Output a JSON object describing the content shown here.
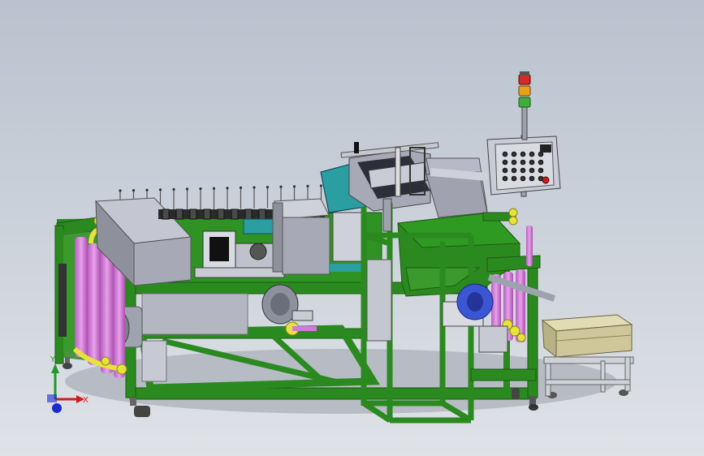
{
  "colors": {
    "background_top": "#b9c2ce",
    "background_bottom": "#dfe2e7",
    "frame_green": "#2b8a1f",
    "frame_green_dark": "#1a5a12",
    "panel_grey": "#a7a9b7",
    "panel_grey_dark": "#7d7f8c",
    "spool_magenta": "#d27ad6",
    "fitting_yellow": "#e8e23a",
    "teal_block": "#2a9ea0",
    "crate_khaki": "#cfc79a",
    "stand_silver": "#cfd3d8",
    "light_red": "#d42a2a",
    "light_orange": "#e8a21a",
    "light_green": "#3fae3a",
    "axis_x": "#d01c1c",
    "axis_y": "#1f9a2a",
    "axis_z": "#1c2ad0"
  },
  "axis_triad": {
    "x_label": "X",
    "y_label": "Y"
  },
  "icons": {
    "signal_tower": "signal-tower-icon",
    "control_panel": "control-panel-icon",
    "caster_wheel": "caster-wheel-icon",
    "axis_triad": "axis-triad-icon"
  }
}
